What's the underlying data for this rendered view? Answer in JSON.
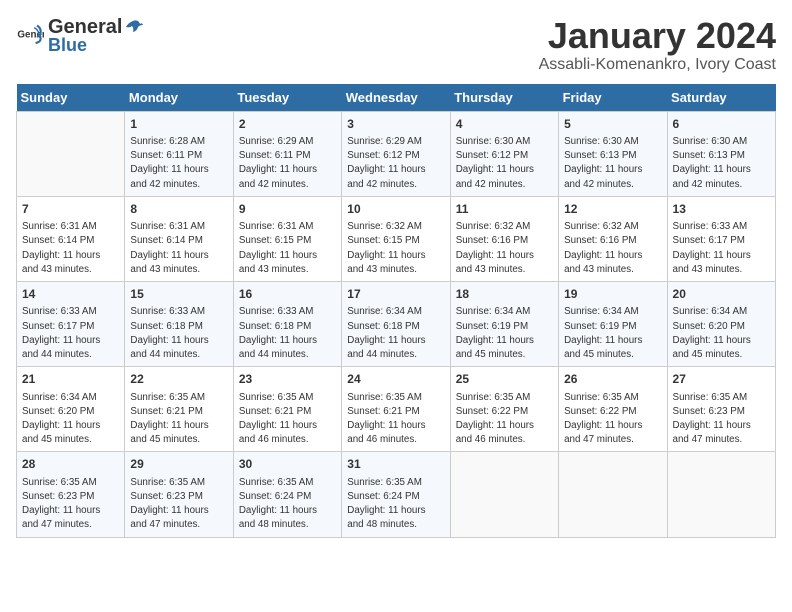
{
  "logo": {
    "text_general": "General",
    "text_blue": "Blue"
  },
  "header": {
    "month": "January 2024",
    "location": "Assabli-Komenankro, Ivory Coast"
  },
  "days_of_week": [
    "Sunday",
    "Monday",
    "Tuesday",
    "Wednesday",
    "Thursday",
    "Friday",
    "Saturday"
  ],
  "weeks": [
    [
      {
        "day": "",
        "info": ""
      },
      {
        "day": "1",
        "info": "Sunrise: 6:28 AM\nSunset: 6:11 PM\nDaylight: 11 hours\nand 42 minutes."
      },
      {
        "day": "2",
        "info": "Sunrise: 6:29 AM\nSunset: 6:11 PM\nDaylight: 11 hours\nand 42 minutes."
      },
      {
        "day": "3",
        "info": "Sunrise: 6:29 AM\nSunset: 6:12 PM\nDaylight: 11 hours\nand 42 minutes."
      },
      {
        "day": "4",
        "info": "Sunrise: 6:30 AM\nSunset: 6:12 PM\nDaylight: 11 hours\nand 42 minutes."
      },
      {
        "day": "5",
        "info": "Sunrise: 6:30 AM\nSunset: 6:13 PM\nDaylight: 11 hours\nand 42 minutes."
      },
      {
        "day": "6",
        "info": "Sunrise: 6:30 AM\nSunset: 6:13 PM\nDaylight: 11 hours\nand 42 minutes."
      }
    ],
    [
      {
        "day": "7",
        "info": "Sunrise: 6:31 AM\nSunset: 6:14 PM\nDaylight: 11 hours\nand 43 minutes."
      },
      {
        "day": "8",
        "info": "Sunrise: 6:31 AM\nSunset: 6:14 PM\nDaylight: 11 hours\nand 43 minutes."
      },
      {
        "day": "9",
        "info": "Sunrise: 6:31 AM\nSunset: 6:15 PM\nDaylight: 11 hours\nand 43 minutes."
      },
      {
        "day": "10",
        "info": "Sunrise: 6:32 AM\nSunset: 6:15 PM\nDaylight: 11 hours\nand 43 minutes."
      },
      {
        "day": "11",
        "info": "Sunrise: 6:32 AM\nSunset: 6:16 PM\nDaylight: 11 hours\nand 43 minutes."
      },
      {
        "day": "12",
        "info": "Sunrise: 6:32 AM\nSunset: 6:16 PM\nDaylight: 11 hours\nand 43 minutes."
      },
      {
        "day": "13",
        "info": "Sunrise: 6:33 AM\nSunset: 6:17 PM\nDaylight: 11 hours\nand 43 minutes."
      }
    ],
    [
      {
        "day": "14",
        "info": "Sunrise: 6:33 AM\nSunset: 6:17 PM\nDaylight: 11 hours\nand 44 minutes."
      },
      {
        "day": "15",
        "info": "Sunrise: 6:33 AM\nSunset: 6:18 PM\nDaylight: 11 hours\nand 44 minutes."
      },
      {
        "day": "16",
        "info": "Sunrise: 6:33 AM\nSunset: 6:18 PM\nDaylight: 11 hours\nand 44 minutes."
      },
      {
        "day": "17",
        "info": "Sunrise: 6:34 AM\nSunset: 6:18 PM\nDaylight: 11 hours\nand 44 minutes."
      },
      {
        "day": "18",
        "info": "Sunrise: 6:34 AM\nSunset: 6:19 PM\nDaylight: 11 hours\nand 45 minutes."
      },
      {
        "day": "19",
        "info": "Sunrise: 6:34 AM\nSunset: 6:19 PM\nDaylight: 11 hours\nand 45 minutes."
      },
      {
        "day": "20",
        "info": "Sunrise: 6:34 AM\nSunset: 6:20 PM\nDaylight: 11 hours\nand 45 minutes."
      }
    ],
    [
      {
        "day": "21",
        "info": "Sunrise: 6:34 AM\nSunset: 6:20 PM\nDaylight: 11 hours\nand 45 minutes."
      },
      {
        "day": "22",
        "info": "Sunrise: 6:35 AM\nSunset: 6:21 PM\nDaylight: 11 hours\nand 45 minutes."
      },
      {
        "day": "23",
        "info": "Sunrise: 6:35 AM\nSunset: 6:21 PM\nDaylight: 11 hours\nand 46 minutes."
      },
      {
        "day": "24",
        "info": "Sunrise: 6:35 AM\nSunset: 6:21 PM\nDaylight: 11 hours\nand 46 minutes."
      },
      {
        "day": "25",
        "info": "Sunrise: 6:35 AM\nSunset: 6:22 PM\nDaylight: 11 hours\nand 46 minutes."
      },
      {
        "day": "26",
        "info": "Sunrise: 6:35 AM\nSunset: 6:22 PM\nDaylight: 11 hours\nand 47 minutes."
      },
      {
        "day": "27",
        "info": "Sunrise: 6:35 AM\nSunset: 6:23 PM\nDaylight: 11 hours\nand 47 minutes."
      }
    ],
    [
      {
        "day": "28",
        "info": "Sunrise: 6:35 AM\nSunset: 6:23 PM\nDaylight: 11 hours\nand 47 minutes."
      },
      {
        "day": "29",
        "info": "Sunrise: 6:35 AM\nSunset: 6:23 PM\nDaylight: 11 hours\nand 47 minutes."
      },
      {
        "day": "30",
        "info": "Sunrise: 6:35 AM\nSunset: 6:24 PM\nDaylight: 11 hours\nand 48 minutes."
      },
      {
        "day": "31",
        "info": "Sunrise: 6:35 AM\nSunset: 6:24 PM\nDaylight: 11 hours\nand 48 minutes."
      },
      {
        "day": "",
        "info": ""
      },
      {
        "day": "",
        "info": ""
      },
      {
        "day": "",
        "info": ""
      }
    ]
  ]
}
